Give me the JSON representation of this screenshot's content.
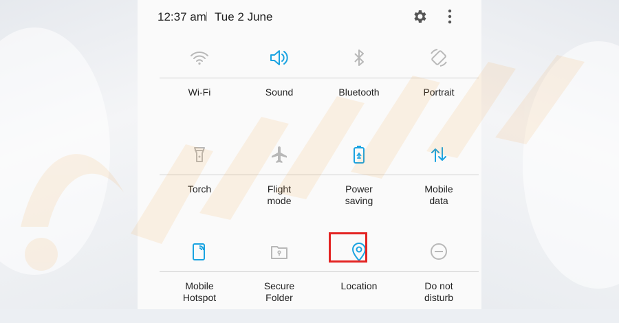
{
  "status": {
    "time": "12:37 am",
    "date": "Tue 2 June"
  },
  "tiles": [
    {
      "label": "Wi-Fi",
      "active": false
    },
    {
      "label": "Sound",
      "active": true
    },
    {
      "label": "Bluetooth",
      "active": false
    },
    {
      "label": "Portrait",
      "active": false
    },
    {
      "label": "Torch",
      "active": false
    },
    {
      "label": "Flight\nmode",
      "active": false
    },
    {
      "label": "Power\nsaving",
      "active": true
    },
    {
      "label": "Mobile\ndata",
      "active": true
    },
    {
      "label": "Mobile\nHotspot",
      "active": true
    },
    {
      "label": "Secure\nFolder",
      "active": false
    },
    {
      "label": "Location",
      "active": true
    },
    {
      "label": "Do not\ndisturb",
      "active": false
    }
  ],
  "colors": {
    "active": "#1aa3e1",
    "inactive": "#b8b8b8",
    "highlight": "#e32322",
    "watermark": "#f7931e"
  },
  "icons": [
    "wifi-icon",
    "sound-icon",
    "bluetooth-icon",
    "portrait-icon",
    "torch-icon",
    "flight-mode-icon",
    "power-saving-icon",
    "mobile-data-icon",
    "mobile-hotspot-icon",
    "secure-folder-icon",
    "location-icon",
    "do-not-disturb-icon"
  ]
}
